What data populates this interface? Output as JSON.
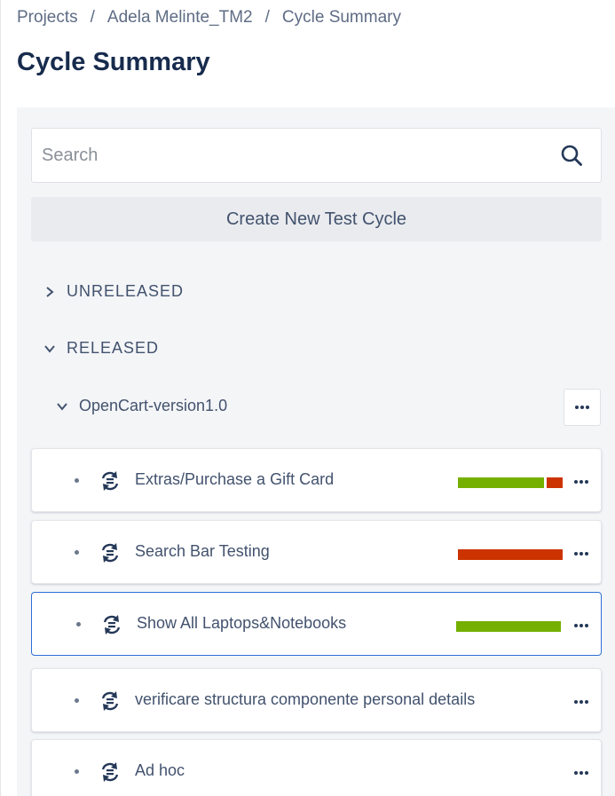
{
  "breadcrumb": {
    "items": [
      "Projects",
      "Adela Melinte_TM2",
      "Cycle Summary"
    ],
    "separator": "/"
  },
  "page_title": "Cycle Summary",
  "search": {
    "placeholder": "Search",
    "value": ""
  },
  "create_button_label": "Create New Test Cycle",
  "groups": {
    "unreleased": {
      "label": "UNRELEASED",
      "expanded": false
    },
    "released": {
      "label": "RELEASED",
      "expanded": true
    }
  },
  "version": {
    "label": "OpenCart-version1.0",
    "expanded": true
  },
  "cycles": [
    {
      "label": "Extras/Purchase a Gift Card",
      "pass_fraction": 0.84,
      "fail_fraction": 0.16,
      "selected": false
    },
    {
      "label": "Search Bar Testing",
      "pass_fraction": 0.0,
      "fail_fraction": 1.0,
      "selected": false
    },
    {
      "label": "Show All Laptops&Notebooks",
      "pass_fraction": 1.0,
      "fail_fraction": 0.0,
      "selected": true
    },
    {
      "label": "verificare  structura componente personal details",
      "pass_fraction": 0,
      "fail_fraction": 0,
      "selected": false
    },
    {
      "label": "Ad hoc",
      "pass_fraction": 0,
      "fail_fraction": 0,
      "selected": false
    }
  ],
  "colors": {
    "pass": "#75b000",
    "fail": "#cc3300",
    "selected_border": "#2f6fd6",
    "panel_bg": "#f4f5f7"
  },
  "icons": {
    "search": "search-icon",
    "collapsed": "chevron-right-icon",
    "expanded": "chevron-down-icon",
    "cycle": "test-cycle-icon",
    "more": "more-icon"
  }
}
